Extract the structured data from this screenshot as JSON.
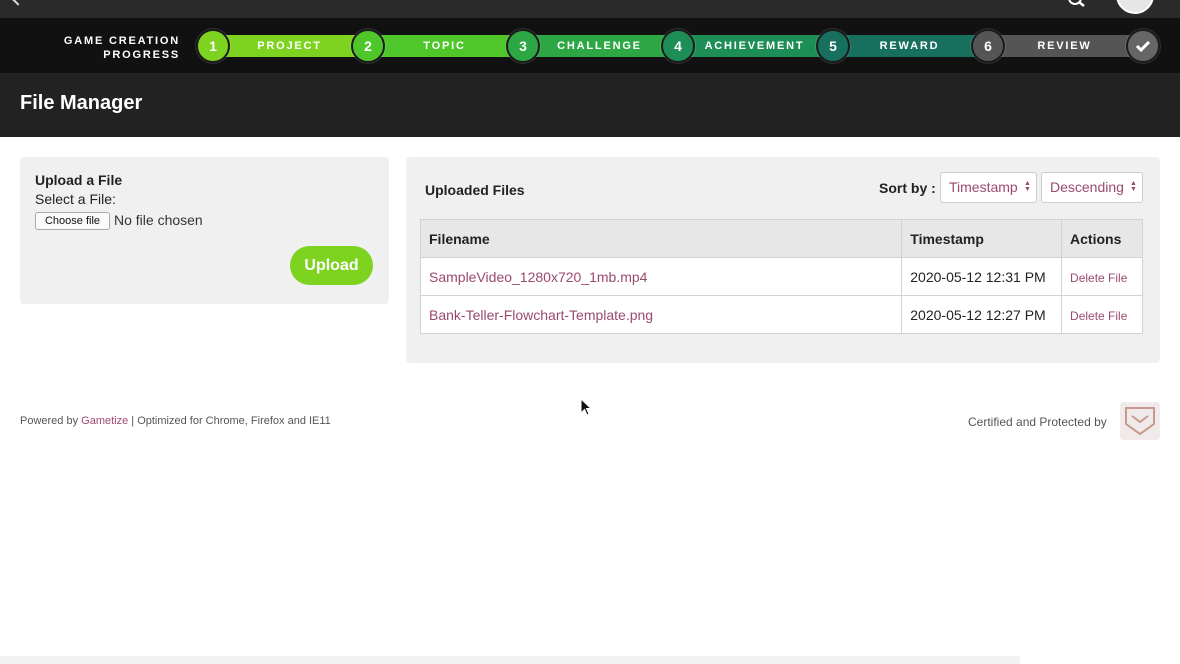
{
  "progress": {
    "label_line1": "GAME CREATION",
    "label_line2": "PROGRESS",
    "steps": [
      {
        "number": "1",
        "label": "PROJECT",
        "color": "#7ed321"
      },
      {
        "number": "2",
        "label": "TOPIC",
        "color": "#4fc72a"
      },
      {
        "number": "3",
        "label": "CHALLENGE",
        "color": "#2da744"
      },
      {
        "number": "4",
        "label": "ACHIEVEMENT",
        "color": "#1e8e57"
      },
      {
        "number": "5",
        "label": "REWARD",
        "color": "#16705d"
      },
      {
        "number": "6",
        "label": "REVIEW",
        "color": "#555555"
      }
    ],
    "final_icon": "checkmark-icon"
  },
  "header": {
    "title": "File Manager"
  },
  "upload": {
    "title": "Upload a File",
    "select_label": "Select a File:",
    "choose_button": "Choose file",
    "no_file_text": "No file chosen",
    "upload_button": "Upload"
  },
  "files": {
    "title": "Uploaded Files",
    "sort_label": "Sort by :",
    "sort_field": "Timestamp",
    "sort_order": "Descending",
    "columns": [
      "Filename",
      "Timestamp",
      "Actions"
    ],
    "rows": [
      {
        "filename": "SampleVideo_1280x720_1mb.mp4",
        "timestamp": "2020-05-12 12:31 PM",
        "action": "Delete File"
      },
      {
        "filename": "Bank-Teller-Flowchart-Template.png",
        "timestamp": "2020-05-12 12:27 PM",
        "action": "Delete File"
      }
    ]
  },
  "footer": {
    "powered_prefix": "Powered by ",
    "powered_brand": "Gametize",
    "powered_suffix": " | Optimized for Chrome, Firefox and IE11",
    "certified": "Certified and Protected by"
  },
  "colors": {
    "accent_link": "#9b4a6e",
    "upload_green": "#7ed321",
    "header_bg": "#222222"
  }
}
